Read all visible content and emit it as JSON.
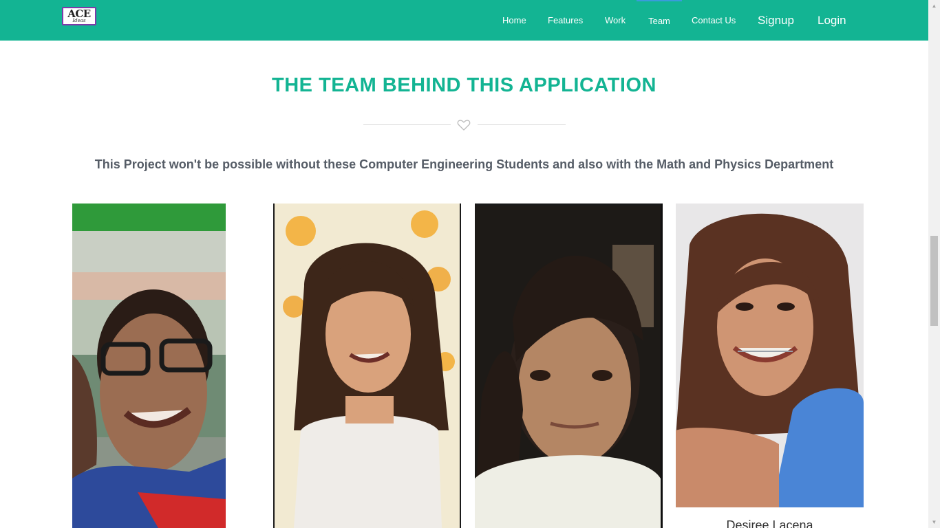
{
  "navbar": {
    "logo": {
      "main": "ACE",
      "sub": "Ideas"
    },
    "items": [
      {
        "label": "Home"
      },
      {
        "label": "Features"
      },
      {
        "label": "Work"
      },
      {
        "label": "Team",
        "active": true
      },
      {
        "label": "Contact Us"
      },
      {
        "label": "Signup"
      },
      {
        "label": "Login"
      }
    ]
  },
  "section": {
    "title": "THE TEAM BEHIND THIS APPLICATION",
    "subtitle": "This Project won't be possible without these Computer Engineering Students and also with the Math and Physics Department",
    "divider_icon": "heart-outline-icon"
  },
  "team": [
    {
      "photo": "member-photo-1",
      "name": ""
    },
    {
      "photo": "member-photo-2",
      "name": ""
    },
    {
      "photo": "member-photo-3",
      "name": ""
    },
    {
      "photo": "member-photo-4",
      "name": "Desiree Lacena"
    }
  ],
  "colors": {
    "brand": "#13b493",
    "subtitle": "#555c66",
    "divider": "#d9d9d9"
  }
}
